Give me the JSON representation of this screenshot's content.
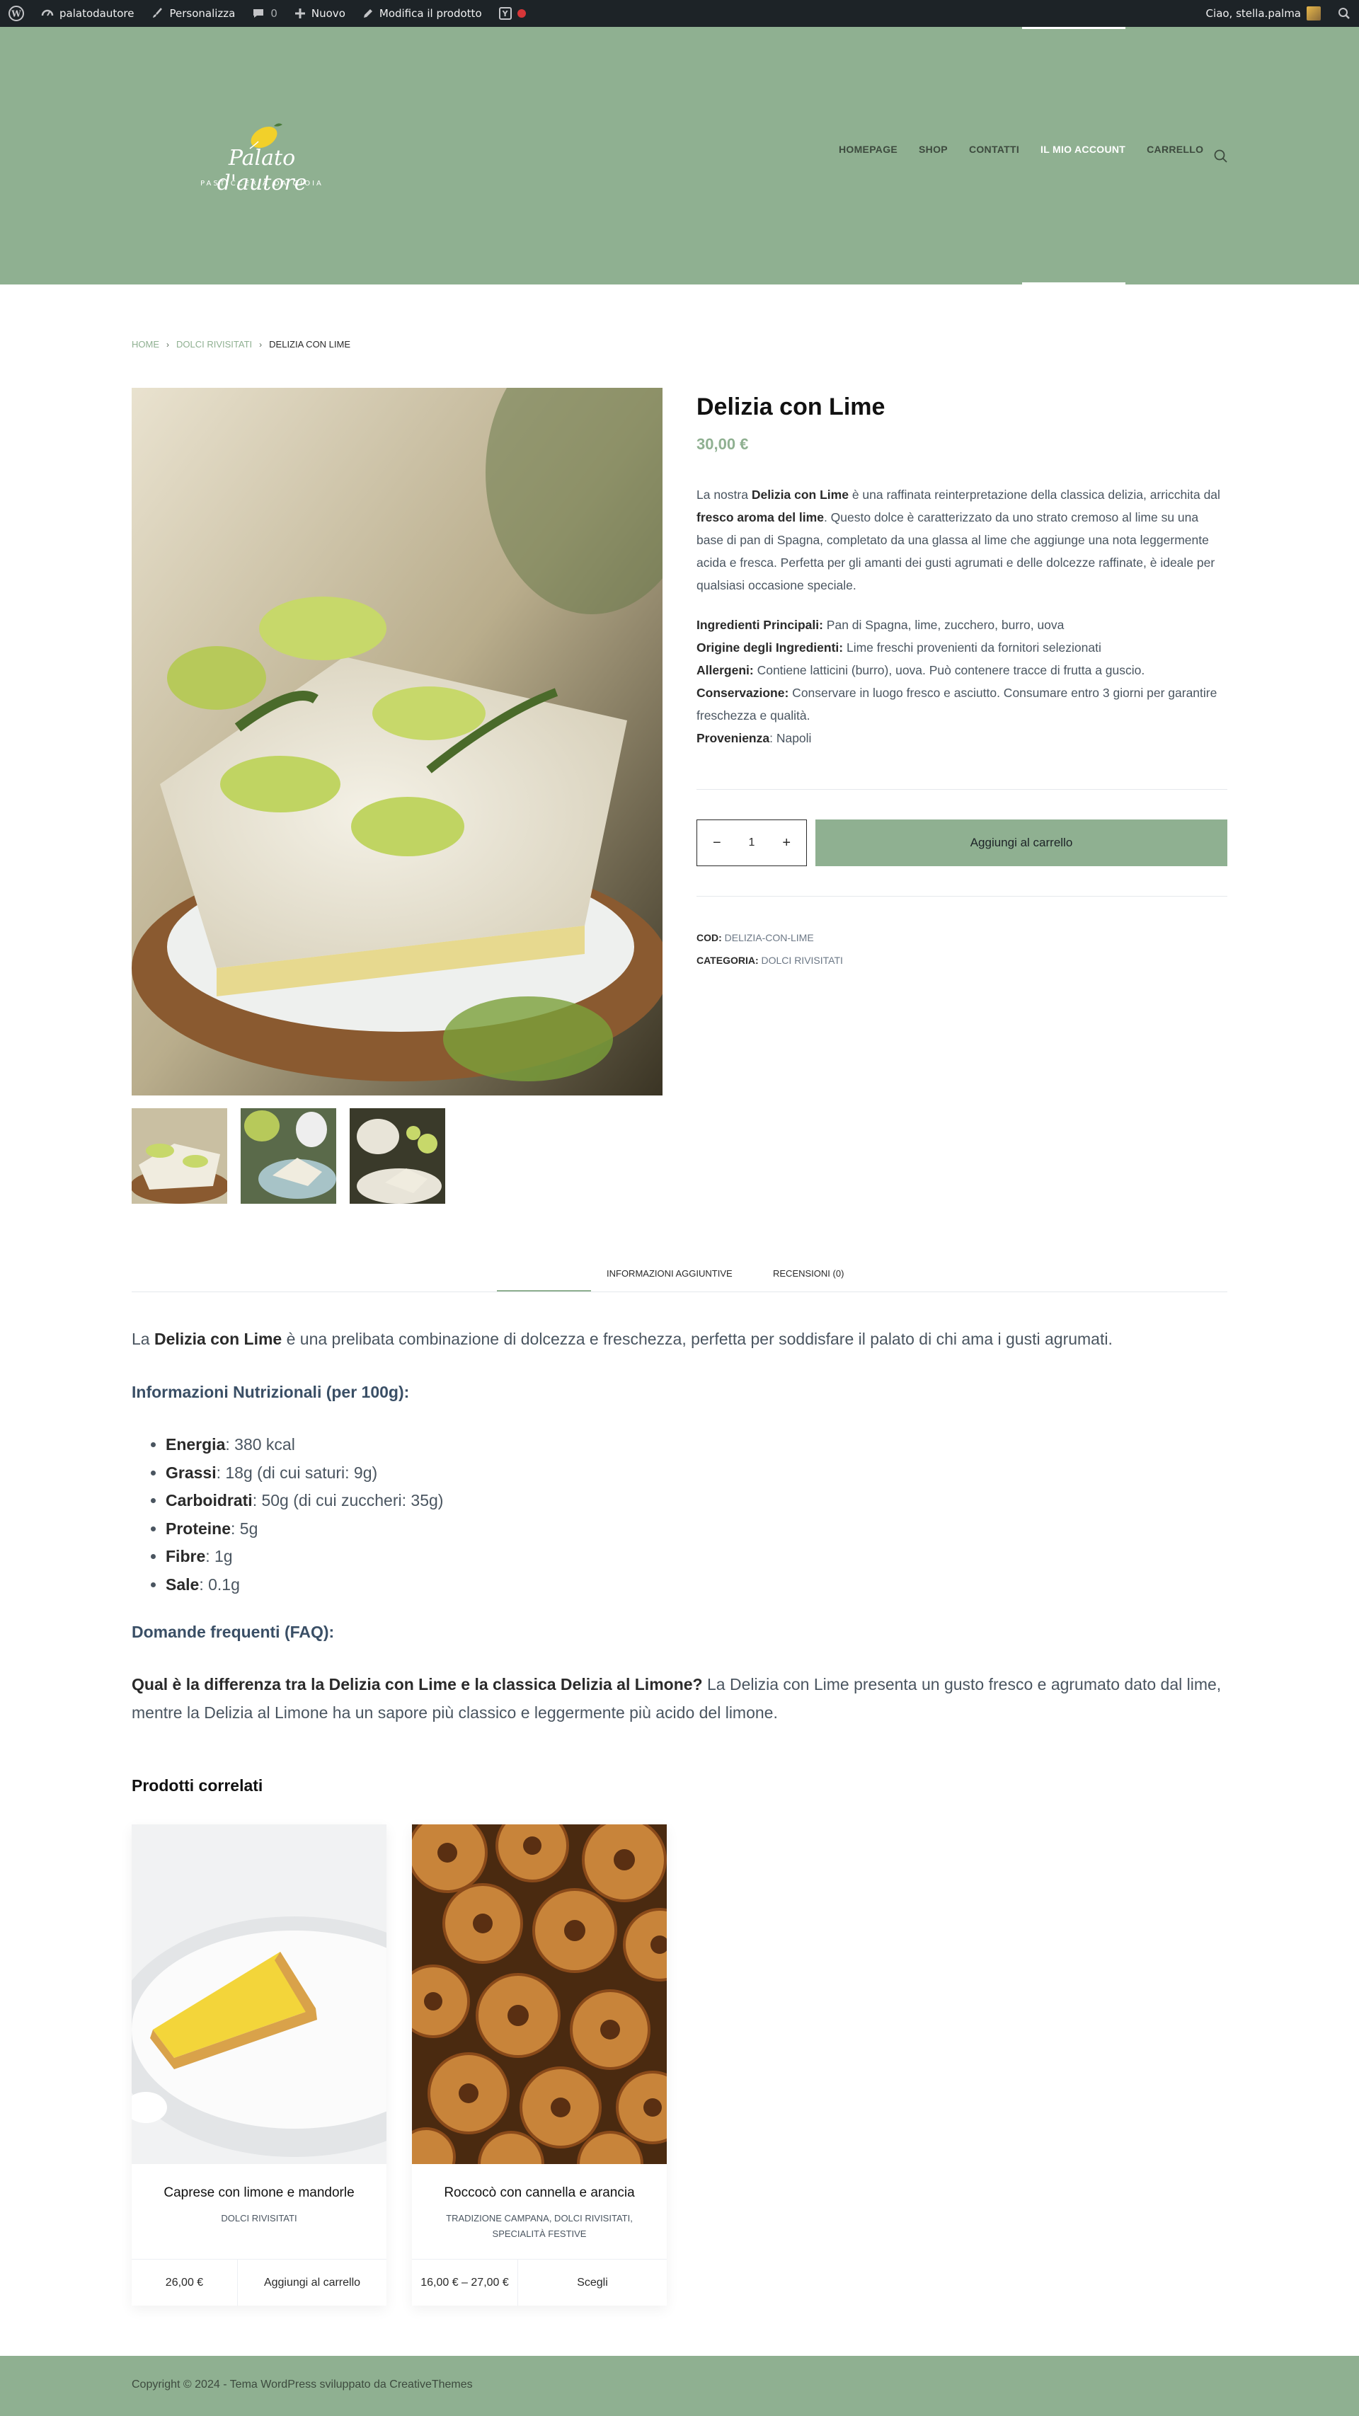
{
  "adminbar": {
    "site_name": "palatodautore",
    "customize": "Personalizza",
    "comments_count": "0",
    "new_label": "Nuovo",
    "edit_label": "Modifica il prodotto",
    "greeting": "Ciao, stella.palma"
  },
  "header": {
    "logo_text": "Palato d'autore",
    "logo_sub": "PASTICCERIA DA GIOIA",
    "nav": [
      "HOMEPAGE",
      "SHOP",
      "CONTATTI",
      "IL MIO ACCOUNT",
      "CARRELLO"
    ],
    "active_nav": "IL MIO ACCOUNT"
  },
  "breadcrumb": {
    "home": "HOME",
    "category": "DOLCI RIVISITATI",
    "current": "DELIZIA CON LIME"
  },
  "product": {
    "title": "Delizia con Lime",
    "price": "30,00 €",
    "desc_1": "La nostra ",
    "desc_bold_1": "Delizia con Lime",
    "desc_2": " è una raffinata reinterpretazione della classica delizia, arricchita dal ",
    "desc_bold_2": "fresco aroma del lime",
    "desc_3": ". Questo dolce è caratterizzato da uno strato cremoso al lime su una base di pan di Spagna, completato da una glassa al lime che aggiunge una nota leggermente acida e fresca. Perfetta per gli amanti dei gusti agrumati e delle dolcezze raffinate, è ideale per qualsiasi occasione speciale.",
    "specs": [
      {
        "label": "Ingredienti Principali:",
        "value": " Pan di Spagna, lime, zucchero, burro, uova"
      },
      {
        "label": "Origine degli Ingredienti:",
        "value": " Lime freschi provenienti da fornitori selezionati"
      },
      {
        "label": "Allergeni:",
        "value": " Contiene latticini (burro), uova. Può contenere tracce di frutta a guscio."
      },
      {
        "label": "Conservazione:",
        "value": " Conservare in luogo fresco e asciutto. Consumare entro 3 giorni per garantire freschezza e qualità."
      },
      {
        "label": "Provenienza",
        "value": ": Napoli"
      }
    ],
    "qty": "1",
    "add_to_cart": "Aggiungi al carrello",
    "sku_label": "COD:",
    "sku": "DELIZIA-CON-LIME",
    "category_label": "CATEGORIA:",
    "category": "DOLCI RIVISITATI"
  },
  "tabs": {
    "info": "INFORMAZIONI AGGIUNTIVE",
    "reviews": "RECENSIONI (0)"
  },
  "long": {
    "intro_1": "La ",
    "intro_bold": "Delizia con Lime",
    "intro_2": " è una prelibata combinazione di dolcezza e freschezza, perfetta per soddisfare il palato di chi ama i gusti agrumati.",
    "nutrition_heading": "Informazioni Nutrizionali (per 100g):",
    "nutrition": [
      {
        "label": "Energia",
        "value": ": 380 kcal"
      },
      {
        "label": "Grassi",
        "value": ": 18g (di cui saturi: 9g)"
      },
      {
        "label": "Carboidrati",
        "value": ": 50g (di cui zuccheri: 35g)"
      },
      {
        "label": "Proteine",
        "value": ": 5g"
      },
      {
        "label": "Fibre",
        "value": ": 1g"
      },
      {
        "label": "Sale",
        "value": ": 0.1g"
      }
    ],
    "faq_heading": "Domande frequenti (FAQ):",
    "faq_q": "Qual è la differenza tra la Delizia con Lime e la classica Delizia al Limone?",
    "faq_a": " La Delizia con Lime presenta un gusto fresco e agrumato dato dal lime, mentre la Delizia al Limone ha un sapore più classico e leggermente più acido del limone."
  },
  "related": {
    "title": "Prodotti correlati",
    "items": [
      {
        "name": "Caprese con limone e mandorle",
        "category": "DOLCI RIVISITATI",
        "price": "26,00 €",
        "button": "Aggiungi al carrello"
      },
      {
        "name": "Roccocò con cannella e arancia",
        "category": "TRADIZIONE CAMPANA, DOLCI RIVISITATI, SPECIALITÀ FESTIVE",
        "price": "16,00 € – 27,00 €",
        "button": "Scegli"
      }
    ]
  },
  "footer": {
    "copyright": "Copyright © 2024 - Tema WordPress sviluppato da CreativeThemes"
  },
  "colors": {
    "brand": "#8fb091",
    "adminbar": "#1d2327"
  }
}
